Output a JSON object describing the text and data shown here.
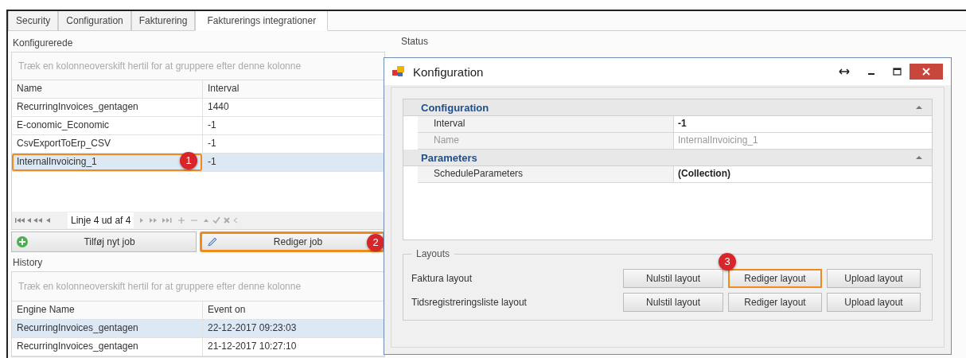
{
  "tabs": [
    {
      "label": "Security",
      "selected": false
    },
    {
      "label": "Configuration",
      "selected": false
    },
    {
      "label": "Fakturering",
      "selected": false
    },
    {
      "label": "Fakturerings integrationer",
      "selected": true
    }
  ],
  "configured": {
    "title": "Konfigurerede",
    "group_hint": "Træk en kolonneoverskift hertil for at gruppere efter denne kolonne",
    "columns": [
      "Name",
      "Interval"
    ],
    "rows": [
      {
        "cells": [
          "RecurringInvoices_gentagen",
          "1440"
        ],
        "selected": false
      },
      {
        "cells": [
          "E-conomic_Economic",
          "-1"
        ],
        "selected": false
      },
      {
        "cells": [
          "CsvExportToErp_CSV",
          "-1"
        ],
        "selected": false
      },
      {
        "cells": [
          "InternalInvoicing_1",
          "-1"
        ],
        "selected": true,
        "callout": "1"
      }
    ],
    "navigator": {
      "position": "Linje 4 ud af 4"
    },
    "buttons": [
      {
        "label": "Tilføj nyt job",
        "kind": "add"
      },
      {
        "label": "Rediger job",
        "kind": "edit",
        "callout": "2"
      }
    ]
  },
  "history": {
    "title": "History",
    "group_hint": "Træk en kolonneoverskift hertil for at gruppere efter denne kolonne",
    "columns": [
      "Engine Name",
      "Event on"
    ],
    "rows": [
      {
        "cells": [
          "RecurringInvoices_gentagen",
          "22-12-2017 09:23:03"
        ],
        "selected": true
      },
      {
        "cells": [
          "RecurringInvoices_gentagen",
          "21-12-2017 10:27:10"
        ],
        "selected": false
      }
    ]
  },
  "status": {
    "title": "Status"
  },
  "dialog": {
    "title": "Konfiguration",
    "categories": [
      {
        "name": "Configuration",
        "expanded": true,
        "properties": [
          {
            "name": "Interval",
            "value": "-1",
            "readonly": false
          },
          {
            "name": "Name",
            "value": "InternalInvoicing_1",
            "readonly": true
          }
        ]
      },
      {
        "name": "Parameters",
        "expanded": true,
        "properties": [
          {
            "name": "ScheduleParameters",
            "value": "(Collection)",
            "readonly": false
          }
        ]
      }
    ],
    "layouts": {
      "title": "Layouts",
      "rows": [
        {
          "label": "Faktura layout",
          "buttons": [
            {
              "label": "Nulstil layout"
            },
            {
              "label": "Rediger layout",
              "callout": "3"
            },
            {
              "label": "Upload layout"
            }
          ]
        },
        {
          "label": "Tidsregistreringsliste layout",
          "buttons": [
            {
              "label": "Nulstil layout"
            },
            {
              "label": "Rediger layout"
            },
            {
              "label": "Upload layout"
            }
          ]
        }
      ]
    }
  }
}
